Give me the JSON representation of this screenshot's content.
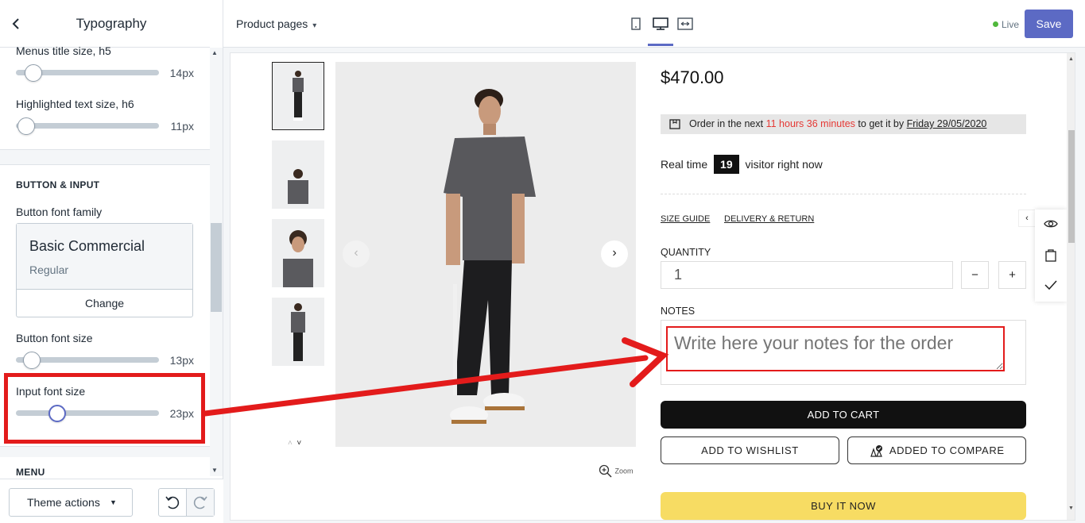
{
  "sidebar": {
    "title": "Typography",
    "settings": [
      {
        "label": "Menus title size, h5",
        "value": "14px",
        "level": 0.12
      },
      {
        "label": "Highlighted text size, h6",
        "value": "11px",
        "level": 0.07
      }
    ],
    "button_input_section": "BUTTON & INPUT",
    "button_font_family_label": "Button font family",
    "font_card": {
      "name": "Basic Commercial",
      "style": "Regular",
      "change_label": "Change"
    },
    "button_font_size": {
      "label": "Button font size",
      "value": "13px",
      "level": 0.11
    },
    "input_font_size": {
      "label": "Input font size",
      "value": "23px",
      "level": 0.29
    },
    "menu_section": "MENU",
    "theme_actions_label": "Theme actions"
  },
  "topbar": {
    "page_select": "Product pages",
    "live_label": "Live",
    "save_label": "Save",
    "accent": "#5c6ac4"
  },
  "product": {
    "price": "$470.00",
    "order_bar": {
      "prefix": "Order in the next",
      "countdown": "11 hours 36 minutes",
      "middle": "to get it by",
      "date": "Friday 29/05/2020"
    },
    "realtime": {
      "prefix": "Real time",
      "count": "19",
      "suffix": "visitor right now"
    },
    "size_guide": "SIZE GUIDE",
    "delivery_return": "DELIVERY & RETURN",
    "quantity_label": "QUANTITY",
    "quantity_value": "1",
    "minus": "−",
    "plus": "+",
    "notes_label": "NOTES",
    "notes_placeholder": "Write here your notes for the order",
    "add_to_cart": "ADD TO CART",
    "add_to_wishlist": "ADD TO WISHLIST",
    "added_to_compare": "ADDED TO COMPARE",
    "buy_now": "BUY IT NOW",
    "zoom_label": "Zoom",
    "highlight_color": "#e31b1b"
  }
}
